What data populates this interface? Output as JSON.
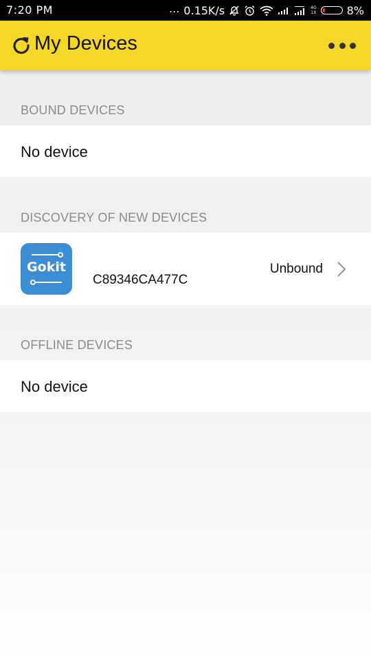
{
  "status_bar": {
    "time": "7:20 PM",
    "dots": "...",
    "speed": "0.15K/s",
    "network_top": "4G",
    "network_bottom": "1X",
    "battery": "8%",
    "icons": [
      "notifications-off-icon",
      "alarm-icon",
      "wifi-icon",
      "signal-icon",
      "signal-icon",
      "battery-icon"
    ]
  },
  "app_bar": {
    "title": "My Devices",
    "refresh_icon": "refresh-icon",
    "more_icon": "more-horizontal-icon",
    "color": "#f5d727"
  },
  "sections": {
    "bound": {
      "header": "BOUND DEVICES",
      "empty_text": "No device"
    },
    "discovery": {
      "header": "DISCOVERY OF NEW DEVICES",
      "devices": [
        {
          "logo_text": "Gokit",
          "mac": "C89346CA477C",
          "status": "Unbound"
        }
      ]
    },
    "offline": {
      "header": "OFFLINE DEVICES",
      "empty_text": "No device"
    }
  },
  "colors": {
    "logo_blue": "#3c8ed4",
    "section_header": "#8a8a8a"
  }
}
